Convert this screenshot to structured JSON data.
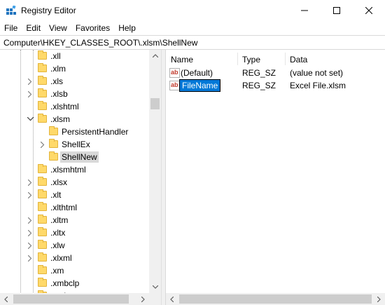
{
  "window": {
    "title": "Registry Editor",
    "icons": {
      "app": "registry-icon",
      "minimize": "minimize-icon",
      "maximize": "maximize-icon",
      "close": "close-icon"
    }
  },
  "menu": [
    "File",
    "Edit",
    "View",
    "Favorites",
    "Help"
  ],
  "address": "Computer\\HKEY_CLASSES_ROOT\\.xlsm\\ShellNew",
  "tree": {
    "items": [
      {
        "label": ".xll",
        "expander": "none"
      },
      {
        "label": ".xlm",
        "expander": "none"
      },
      {
        "label": ".xls",
        "expander": "collapsed"
      },
      {
        "label": ".xlsb",
        "expander": "collapsed"
      },
      {
        "label": ".xlshtml",
        "expander": "none"
      },
      {
        "label": ".xlsm",
        "expander": "expanded"
      },
      {
        "label": "PersistentHandler",
        "expander": "none"
      },
      {
        "label": "ShellEx",
        "expander": "collapsed"
      },
      {
        "label": "ShellNew",
        "expander": "none"
      },
      {
        "label": ".xlsmhtml",
        "expander": "none"
      },
      {
        "label": ".xlsx",
        "expander": "collapsed"
      },
      {
        "label": ".xlt",
        "expander": "collapsed"
      },
      {
        "label": ".xlthtml",
        "expander": "none"
      },
      {
        "label": ".xltm",
        "expander": "collapsed"
      },
      {
        "label": ".xltx",
        "expander": "collapsed"
      },
      {
        "label": ".xlw",
        "expander": "collapsed"
      },
      {
        "label": ".xlxml",
        "expander": "collapsed"
      },
      {
        "label": ".xm",
        "expander": "none"
      },
      {
        "label": ".xmbclp",
        "expander": "none"
      },
      {
        "label": ".xmbcp",
        "expander": "none"
      }
    ],
    "selected": "ShellNew"
  },
  "list": {
    "columns": [
      "Name",
      "Type",
      "Data"
    ],
    "rows": [
      {
        "name": "(Default)",
        "type": "REG_SZ",
        "data": "(value not set)",
        "icon": "string-value-icon"
      },
      {
        "name": "FileName",
        "type": "REG_SZ",
        "data": "Excel File.xlsm",
        "icon": "string-value-icon",
        "editing": true
      }
    ]
  },
  "colors": {
    "selection": "#0078d7",
    "tree_selected": "#d9d9d9",
    "folder": "#ffd96a"
  }
}
